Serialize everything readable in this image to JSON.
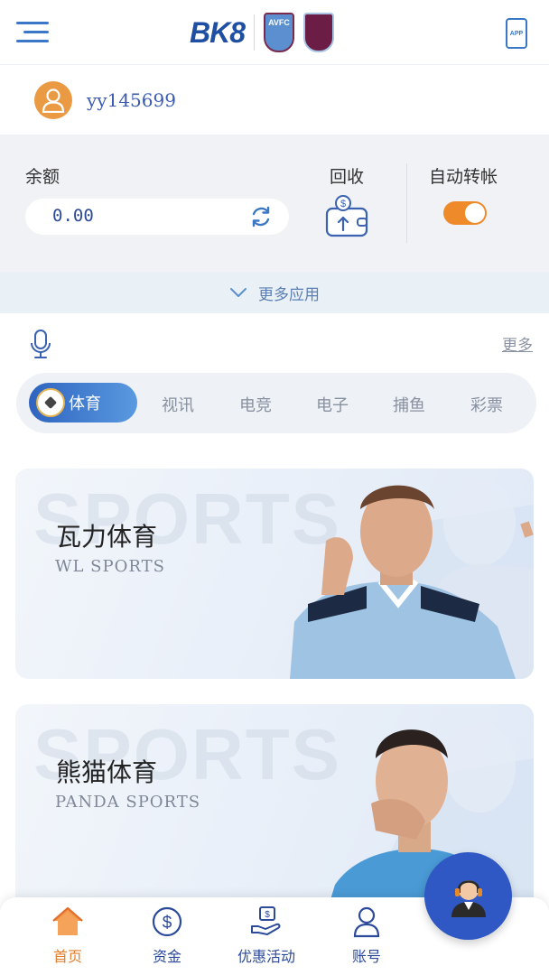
{
  "header": {
    "logo_text": "BK8",
    "partner_crest_1": "AVFC",
    "app_label": "APP"
  },
  "user": {
    "username": "yy145699"
  },
  "wallet": {
    "balance_label": "余额",
    "balance_value": "0.00",
    "recall_label": "回收",
    "auto_transfer_label": "自动转帐",
    "auto_transfer_on": true
  },
  "more_apps": {
    "label": "更多应用"
  },
  "more_link": {
    "label": "更多"
  },
  "tabs": {
    "active": "体育",
    "items": [
      "视讯",
      "电竞",
      "电子",
      "捕鱼",
      "彩票"
    ]
  },
  "cards": [
    {
      "title": "瓦力体育",
      "subtitle": "WL SPORTS",
      "watermark": "SPORTS"
    },
    {
      "title": "熊猫体育",
      "subtitle": "PANDA SPORTS",
      "watermark": "SPORTS"
    }
  ],
  "bottom_nav": {
    "items": [
      {
        "label": "首页",
        "icon": "home-icon",
        "active": true
      },
      {
        "label": "资金",
        "icon": "dollar-coin-icon",
        "active": false
      },
      {
        "label": "优惠活动",
        "icon": "promo-hand-icon",
        "active": false
      },
      {
        "label": "账号",
        "icon": "user-icon",
        "active": false
      }
    ]
  },
  "colors": {
    "brand_blue": "#2e63bf",
    "accent_orange": "#ef8a2b"
  }
}
